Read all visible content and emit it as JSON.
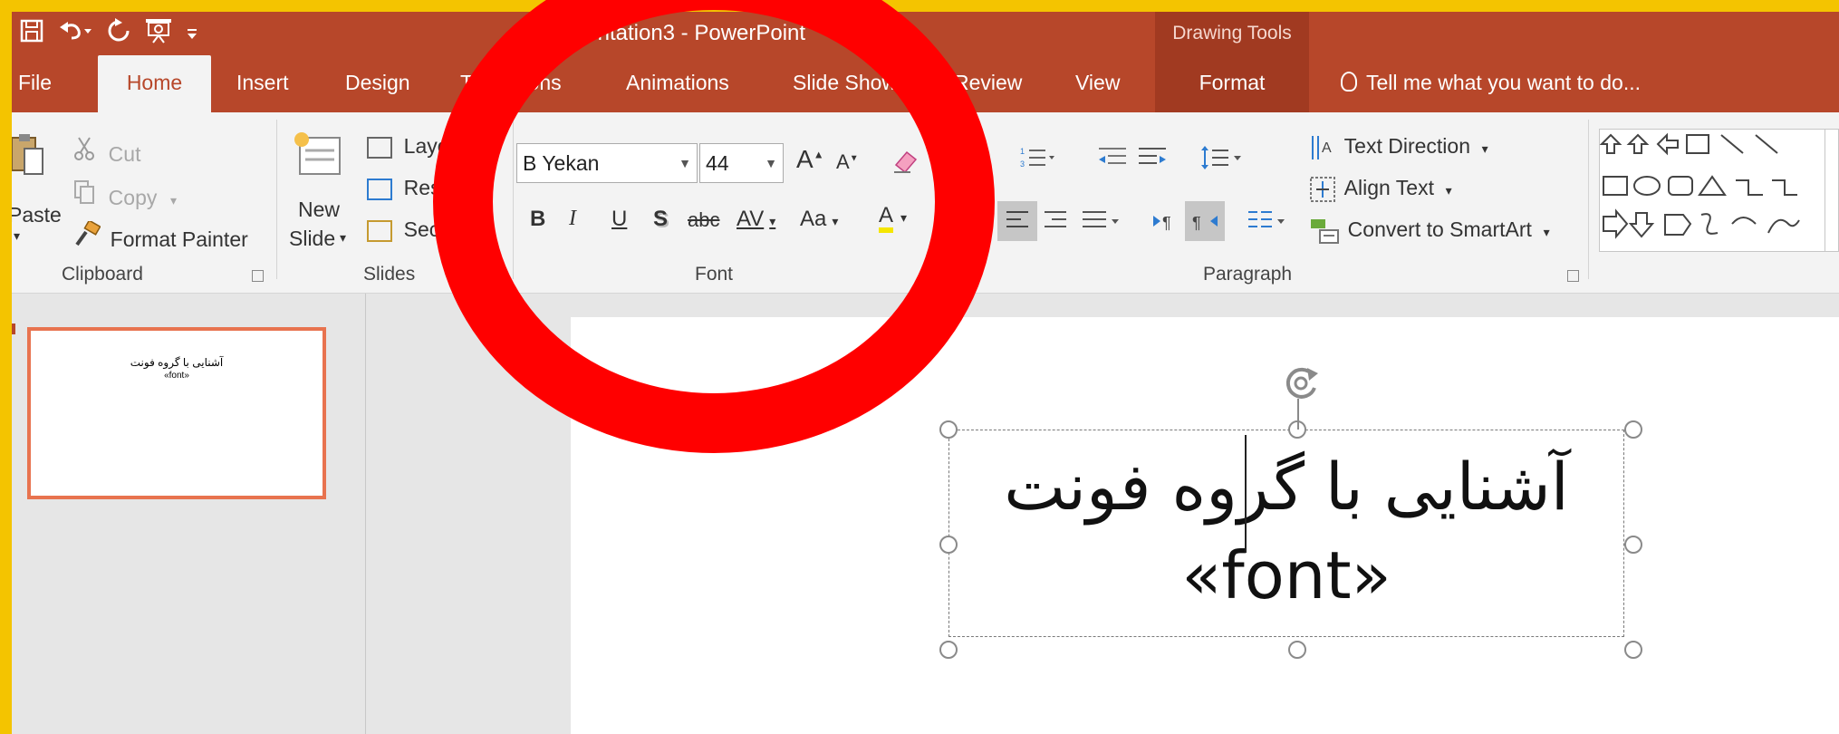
{
  "window": {
    "title": "Presentation3 - PowerPoint",
    "context_tab_group": "Drawing Tools"
  },
  "tabs": [
    "File",
    "Home",
    "Insert",
    "Design",
    "Transitions",
    "Animations",
    "Slide Show",
    "Review",
    "View",
    "Format"
  ],
  "active_tab": "Home",
  "tell_me": "Tell me what you want to do...",
  "clipboard": {
    "paste": "Paste",
    "cut": "Cut",
    "copy": "Copy",
    "format_painter": "Format Painter",
    "label": "Clipboard"
  },
  "slides_group": {
    "new_slide_1": "New",
    "new_slide_2": "Slide",
    "layout": "Layout",
    "reset": "Reset",
    "section": "Section",
    "label": "Slides"
  },
  "font": {
    "name": "B Yekan",
    "size": "44",
    "bold": "B",
    "italic": "I",
    "underline": "U",
    "shadow": "S",
    "strike": "abc",
    "spacing": "AV",
    "case": "Aa",
    "color": "A",
    "grow": "A",
    "shrink": "A",
    "label": "Font"
  },
  "paragraph": {
    "text_direction": "Text Direction",
    "align_text": "Align Text",
    "convert_smartart": "Convert to SmartArt",
    "label": "Paragraph"
  },
  "thumbnail": {
    "line1": "آشنایی با گروه فونت",
    "line2": "«font»"
  },
  "slide_text": {
    "line1": "آشنایی با گروه فونت",
    "line2": "«font»"
  },
  "colors": {
    "accent": "#b7472a",
    "context_tab": "#a13a21",
    "frame": "#f4c400",
    "annotation": "#ff0000",
    "thumb_border": "#e8734f"
  }
}
